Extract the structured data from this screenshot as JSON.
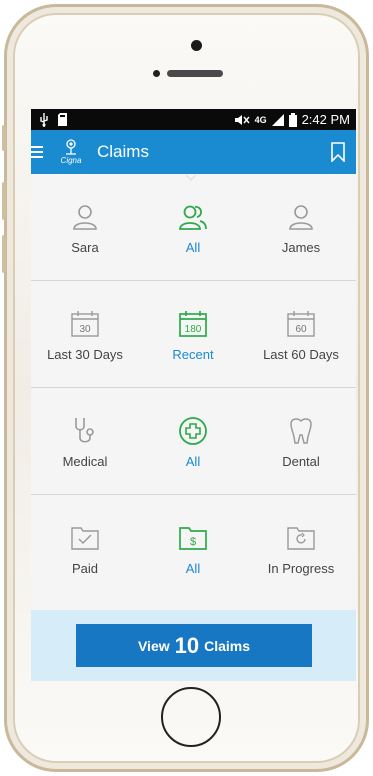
{
  "status_bar": {
    "time": "2:42 PM",
    "network": "4G"
  },
  "app_bar": {
    "logo_text": "Cigna",
    "title": "Claims"
  },
  "filters": {
    "people": [
      {
        "label": "Sara",
        "icon": "person-icon",
        "active": false
      },
      {
        "label": "All",
        "icon": "people-icon",
        "active": true
      },
      {
        "label": "James",
        "icon": "person-icon",
        "active": false
      }
    ],
    "dates": [
      {
        "label": "Last 30 Days",
        "number": "30",
        "icon": "calendar-icon",
        "active": false
      },
      {
        "label": "Recent",
        "number": "180",
        "icon": "calendar-icon",
        "active": true
      },
      {
        "label": "Last 60 Days",
        "number": "60",
        "icon": "calendar-icon",
        "active": false
      }
    ],
    "types": [
      {
        "label": "Medical",
        "icon": "stethoscope-icon",
        "active": false
      },
      {
        "label": "All",
        "icon": "plus-circle-icon",
        "active": true
      },
      {
        "label": "Dental",
        "icon": "tooth-icon",
        "active": false
      }
    ],
    "statuses": [
      {
        "label": "Paid",
        "icon": "folder-check-icon",
        "active": false
      },
      {
        "label": "All",
        "icon": "folder-dollar-icon",
        "active": true
      },
      {
        "label": "In Progress",
        "icon": "folder-refresh-icon",
        "active": false
      }
    ]
  },
  "footer": {
    "button_prefix": "View",
    "claims_count": "10",
    "button_suffix": "Claims"
  },
  "colors": {
    "brand_blue": "#1a8ad1",
    "active_green": "#2eaa4a",
    "inactive_gray": "#9a9a9a",
    "footer_bg": "#d6ecf9",
    "button_blue": "#1877c3"
  }
}
